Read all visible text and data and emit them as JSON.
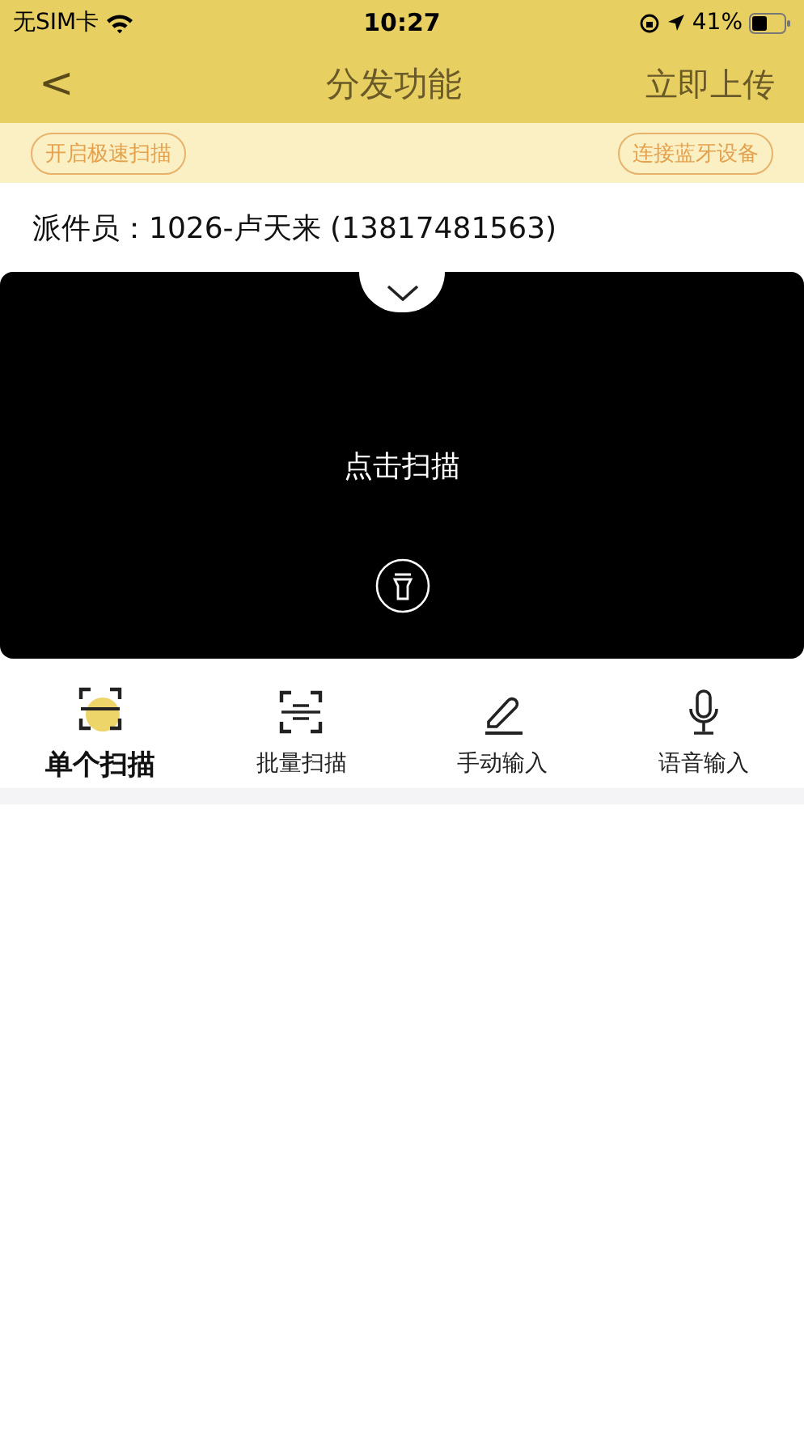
{
  "status_bar": {
    "carrier": "无SIM卡",
    "time": "10:27",
    "battery": "41%"
  },
  "nav": {
    "back": "<",
    "title": "分发功能",
    "action": "立即上传"
  },
  "toolbar": {
    "left_button": "开启极速扫描",
    "right_button": "连接蓝牙设备"
  },
  "courier": "派件员：1026-卢天来 (13817481563)",
  "scanner": {
    "prompt": "点击扫描"
  },
  "modes": [
    {
      "label": "单个扫描",
      "kind": "single",
      "selected": true
    },
    {
      "label": "批量扫描",
      "kind": "batch",
      "selected": false
    },
    {
      "label": "手动输入",
      "kind": "pen",
      "selected": false
    },
    {
      "label": "语音输入",
      "kind": "mic",
      "selected": false
    }
  ]
}
